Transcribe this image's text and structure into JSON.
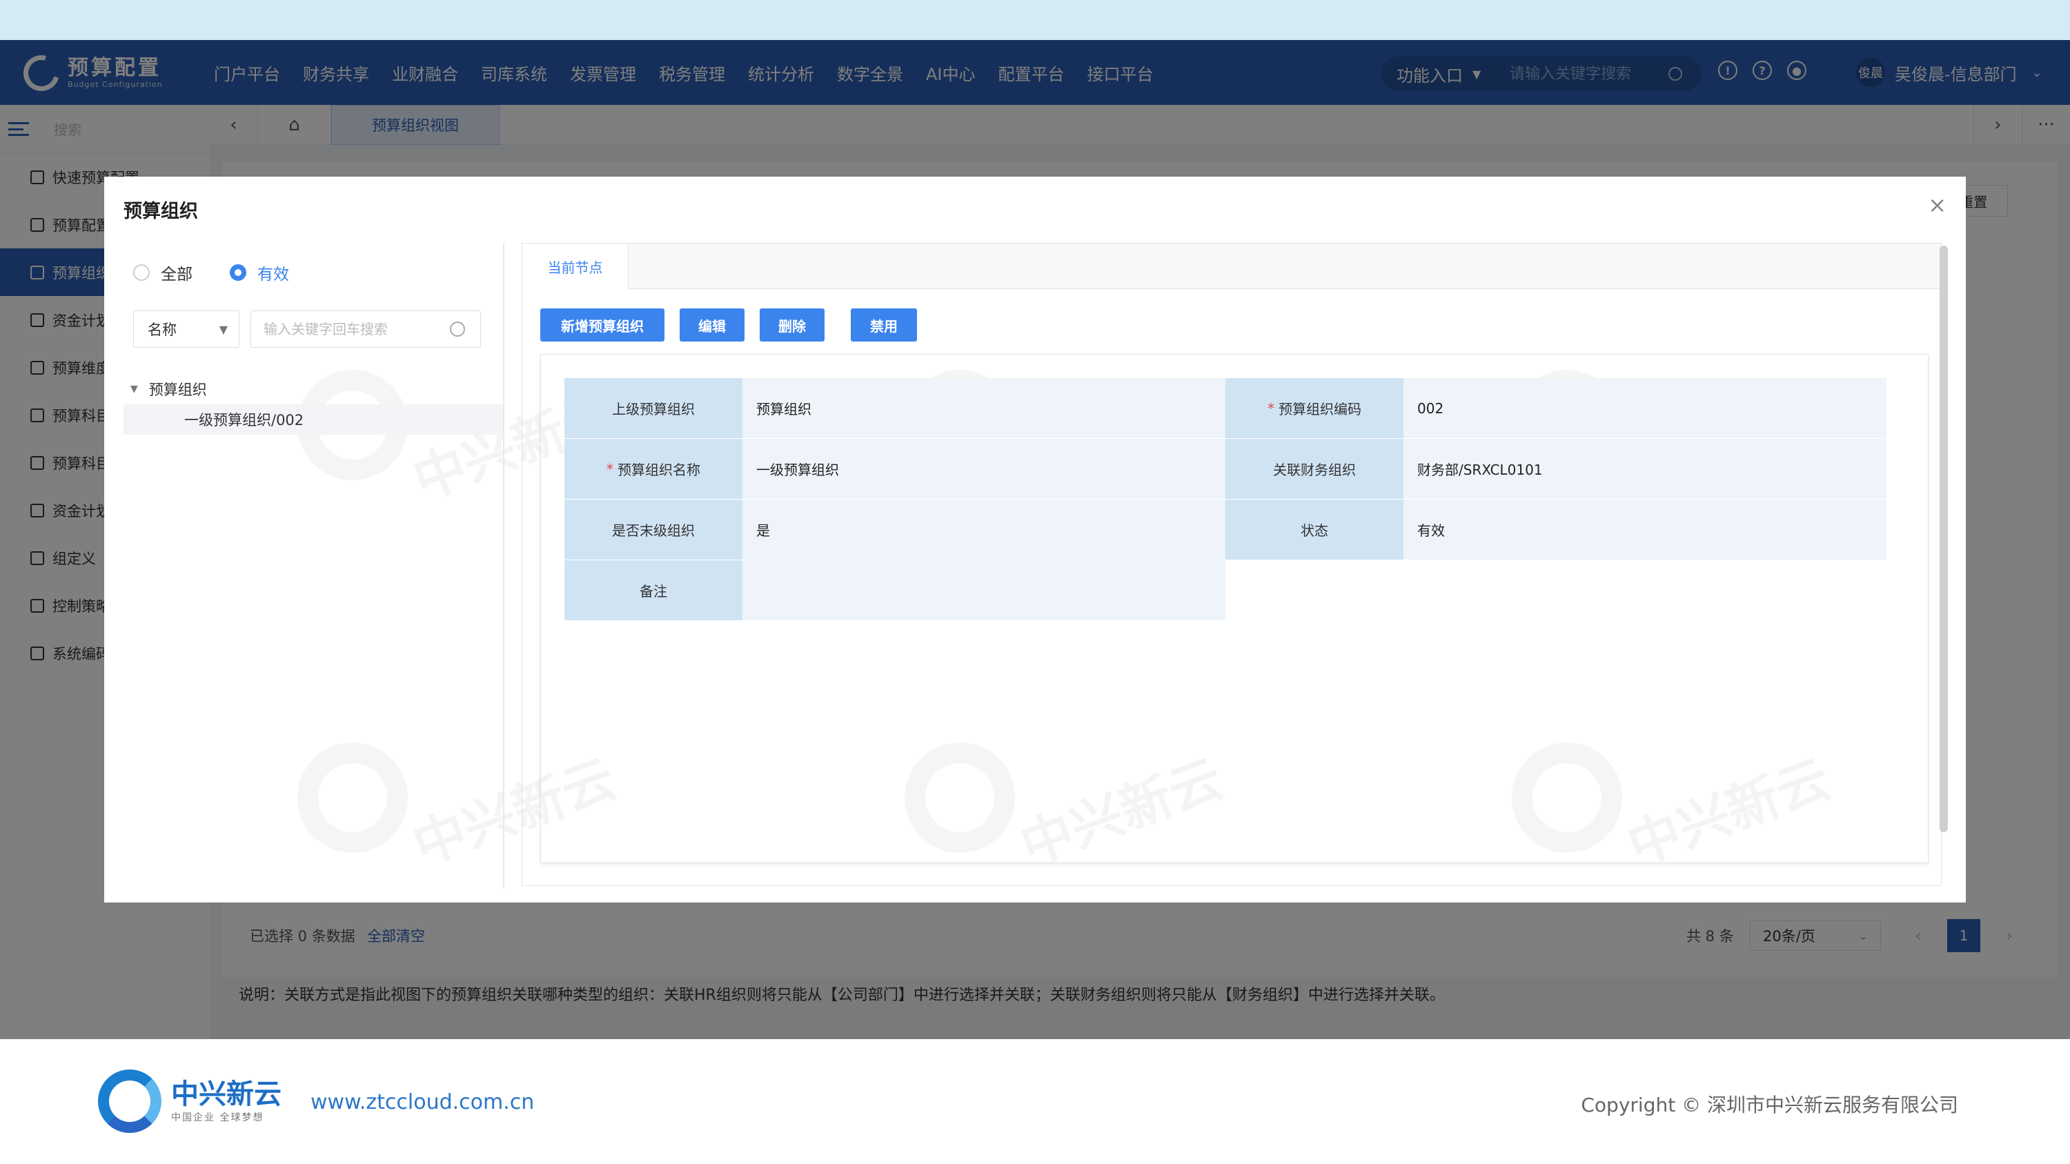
{
  "app": {
    "logo_title": "预算配置",
    "logo_sub": "Budget Configuration",
    "nav": [
      "门户平台",
      "财务共享",
      "业财融合",
      "司库系统",
      "发票管理",
      "税务管理",
      "统计分析",
      "数字全景",
      "AI中心",
      "配置平台",
      "接口平台"
    ],
    "function_entry": "功能入口",
    "search_placeholder": "请输入关键字搜索",
    "avatar_text": "俊晨",
    "user_name": "吴俊晨-信息部门",
    "brand_color": "#2c5fb4",
    "accent_color": "#3b84ee"
  },
  "sidebar": {
    "search_placeholder": "搜索",
    "items": [
      {
        "label": "快速预算配置",
        "active": false
      },
      {
        "label": "预算配置",
        "active": false
      },
      {
        "label": "预算组织",
        "active": true
      },
      {
        "label": "资金计划",
        "active": false
      },
      {
        "label": "预算维度",
        "active": false
      },
      {
        "label": "预算科目",
        "active": false
      },
      {
        "label": "预算科目",
        "active": false
      },
      {
        "label": "资金计划",
        "active": false
      },
      {
        "label": "组定义",
        "active": false
      },
      {
        "label": "控制策略",
        "active": false
      },
      {
        "label": "系统编码",
        "active": false
      }
    ]
  },
  "tabs": {
    "prev_icon": "‹",
    "home_icon": "⌂",
    "active_tab": "预算组织视图",
    "next_icon": "›",
    "more_icon": "···"
  },
  "background": {
    "reset_label": "重置",
    "selected_text": "已选择 0 条数据",
    "clear_all": "全部清空",
    "total": "共 8 条",
    "page_size": "20条/页",
    "current_page": "1",
    "note": "说明：关联方式是指此视图下的预算组织关联哪种类型的组织：关联HR组织则将只能从【公司部门】中进行选择并关联；关联财务组织则将只能从【财务组织】中进行选择并关联。"
  },
  "modal": {
    "title": "预算组织",
    "close_icon": "×",
    "filter": {
      "radio_all": "全部",
      "radio_valid": "有效",
      "selected": "有效",
      "field_select": "名称",
      "search_placeholder": "输入关键字回车搜索"
    },
    "tree": {
      "root": "预算组织",
      "children": [
        "一级预算组织/002"
      ]
    },
    "tab_label": "当前节点",
    "buttons": {
      "add": "新增预算组织",
      "edit": "编辑",
      "delete": "删除",
      "disable": "禁用"
    },
    "fields": {
      "parent_label": "上级预算组织",
      "parent_value": "预算组织",
      "code_label": "预算组织编码",
      "code_value": "002",
      "name_label": "预算组织名称",
      "name_value": "一级预算组织",
      "finance_org_label": "关联财务组织",
      "finance_org_value": "财务部/SRXCL0101",
      "is_leaf_label": "是否末级组织",
      "is_leaf_value": "是",
      "status_label": "状态",
      "status_value": "有效",
      "remark_label": "备注",
      "remark_value": ""
    },
    "required_mark": "*"
  },
  "watermark": {
    "text": "中兴新云"
  },
  "footer": {
    "brand_name": "中兴新云",
    "brand_slogan": "中国企业 全球梦想",
    "url": "www.ztccloud.com.cn",
    "copyright": "Copyright © 深圳市中兴新云服务有限公司"
  }
}
